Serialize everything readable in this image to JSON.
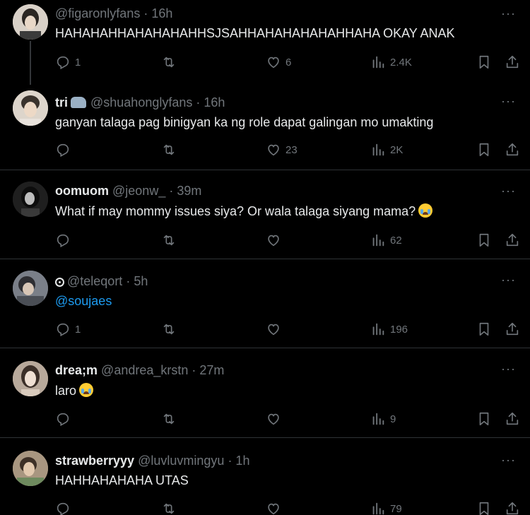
{
  "more_label": "···",
  "tweets": [
    {
      "name": "",
      "handle": "@figaronlyfans",
      "time": "· 16h",
      "text": "HAHAHAHHAHAHAHAHHSJSAHHAHAHAHAHAHHAHA OKAY ANAK",
      "replies": "1",
      "likes": "6",
      "views": "2.4K",
      "avatar_color": "#cfc6bc"
    },
    {
      "name": "tri",
      "handle": "@shuahonglyfans",
      "time": "· 16h",
      "text": "ganyan talaga pag binigyan ka ng role dapat galingan mo umakting",
      "replies": "",
      "likes": "23",
      "views": "2K",
      "avatar_color": "#d8cfc4"
    },
    {
      "name": "oomuom",
      "handle": "@jeonw_",
      "time": "· 39m",
      "text": "What if may mommy issues siya? Or wala talaga siyang mama?",
      "replies": "",
      "likes": "",
      "views": "62",
      "avatar_color": "#2a2a2a"
    },
    {
      "name": "",
      "handle": "@teleqort",
      "time": "· 5h",
      "text": "@soujaes",
      "replies": "1",
      "likes": "",
      "views": "196",
      "avatar_color": "#6b6f78"
    },
    {
      "name": "drea;m",
      "handle": "@andrea_krstn",
      "time": "· 27m",
      "text": "laro",
      "replies": "",
      "likes": "",
      "views": "9",
      "avatar_color": "#c9b9a9"
    },
    {
      "name": "strawberryyy",
      "handle": "@luvluvmingyu",
      "time": "· 1h",
      "text": "HAHHAHAHAHA UTAS",
      "replies": "",
      "likes": "",
      "views": "79",
      "avatar_color": "#b9a58e"
    }
  ],
  "icons": {
    "reply": "reply-icon",
    "retweet": "retweet-icon",
    "like": "heart-icon",
    "views": "views-icon",
    "bookmark": "bookmark-icon",
    "share": "share-icon"
  }
}
